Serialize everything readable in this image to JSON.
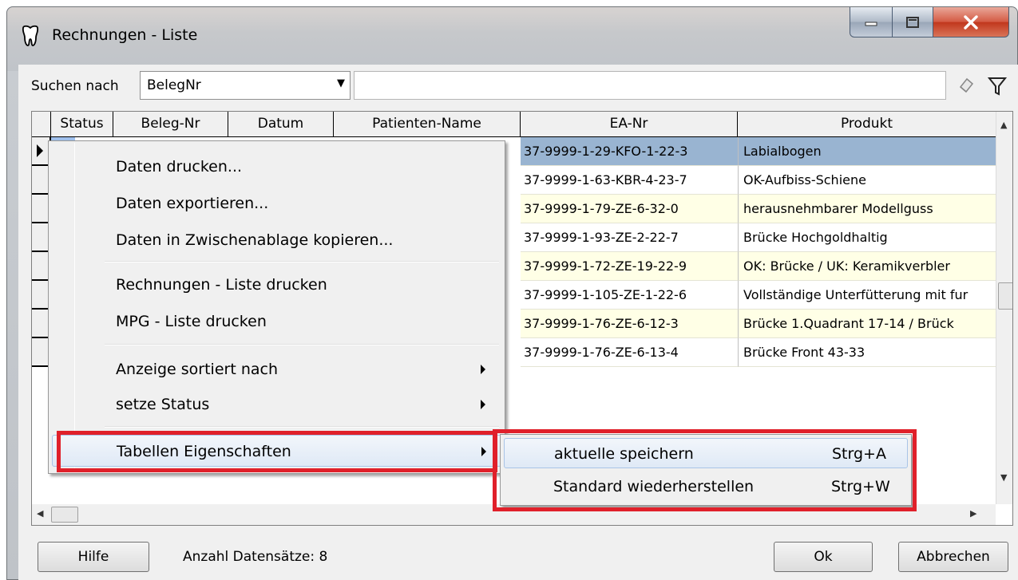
{
  "window": {
    "title": "Rechnungen - Liste",
    "icon": "tooth-icon",
    "controls": {
      "minimize": "minimize-icon",
      "maximize": "maximize-icon",
      "close": "close-icon"
    }
  },
  "search": {
    "label": "Suchen nach",
    "field_selected": "BelegNr",
    "input_value": "",
    "clear_icon": "eraser-icon",
    "filter_icon": "filter-icon"
  },
  "grid": {
    "columns": [
      "Status",
      "Beleg-Nr",
      "Datum",
      "Patienten-Name",
      "EA-Nr",
      "Produkt"
    ],
    "rows": [
      {
        "ea_nr": "37-9999-1-29-KFO-1-22-3",
        "produkt": "Labialbogen",
        "selected": true,
        "strip": "#9fc0ec"
      },
      {
        "ea_nr": "37-9999-1-63-KBR-4-23-7",
        "produkt": "OK-Aufbiss-Schiene",
        "selected": false,
        "strip": "#9fc0ec"
      },
      {
        "ea_nr": "37-9999-1-79-ZE-6-32-0",
        "produkt": "herausnehmbarer Modellguss",
        "selected": false,
        "strip": "#9fc0ec"
      },
      {
        "ea_nr": "37-9999-1-93-ZE-2-22-7",
        "produkt": "Brücke Hochgoldhaltig",
        "selected": false,
        "strip": "#9fc0ec"
      },
      {
        "ea_nr": "37-9999-1-72-ZE-19-22-9",
        "produkt": "OK: Brücke / UK: Keramikverbler",
        "selected": false,
        "strip": "#9fc0ec"
      },
      {
        "ea_nr": "37-9999-1-105-ZE-1-22-6",
        "produkt": "Vollständige Unterfütterung mit fur",
        "selected": false,
        "strip": "#c8c8c8"
      },
      {
        "ea_nr": "37-9999-1-76-ZE-6-12-3",
        "produkt": "Brücke 1.Quadrant 17-14 / Brück",
        "selected": false,
        "strip": "#9fc0ec"
      },
      {
        "ea_nr": "37-9999-1-76-ZE-6-13-4",
        "produkt": "Brücke Front 43-33",
        "selected": false,
        "strip": "#c8c8c8"
      }
    ]
  },
  "context_menu": {
    "items": [
      {
        "label": "Daten drucken..."
      },
      {
        "label": "Daten exportieren..."
      },
      {
        "label": "Daten in Zwischenablage kopieren..."
      },
      {
        "label": "Rechnungen - Liste drucken"
      },
      {
        "label": "MPG - Liste drucken"
      },
      {
        "label": "Anzeige sortiert nach"
      },
      {
        "label": "setze Status"
      },
      {
        "label": "Tabellen Eigenschaften"
      }
    ]
  },
  "submenu": {
    "items": [
      {
        "label": "aktuelle speichern",
        "shortcut": "Strg+A"
      },
      {
        "label": "Standard wiederherstellen",
        "shortcut": "Strg+W"
      }
    ]
  },
  "footer": {
    "help_label": "Hilfe",
    "record_count": "Anzahl Datensätze: 8",
    "ok_label": "Ok",
    "cancel_label": "Abbrechen"
  },
  "colors": {
    "row_odd": "#ffffe6",
    "row_even": "#ffffff",
    "row_selected": "#99b4d1",
    "highlight": "#e0202a"
  }
}
